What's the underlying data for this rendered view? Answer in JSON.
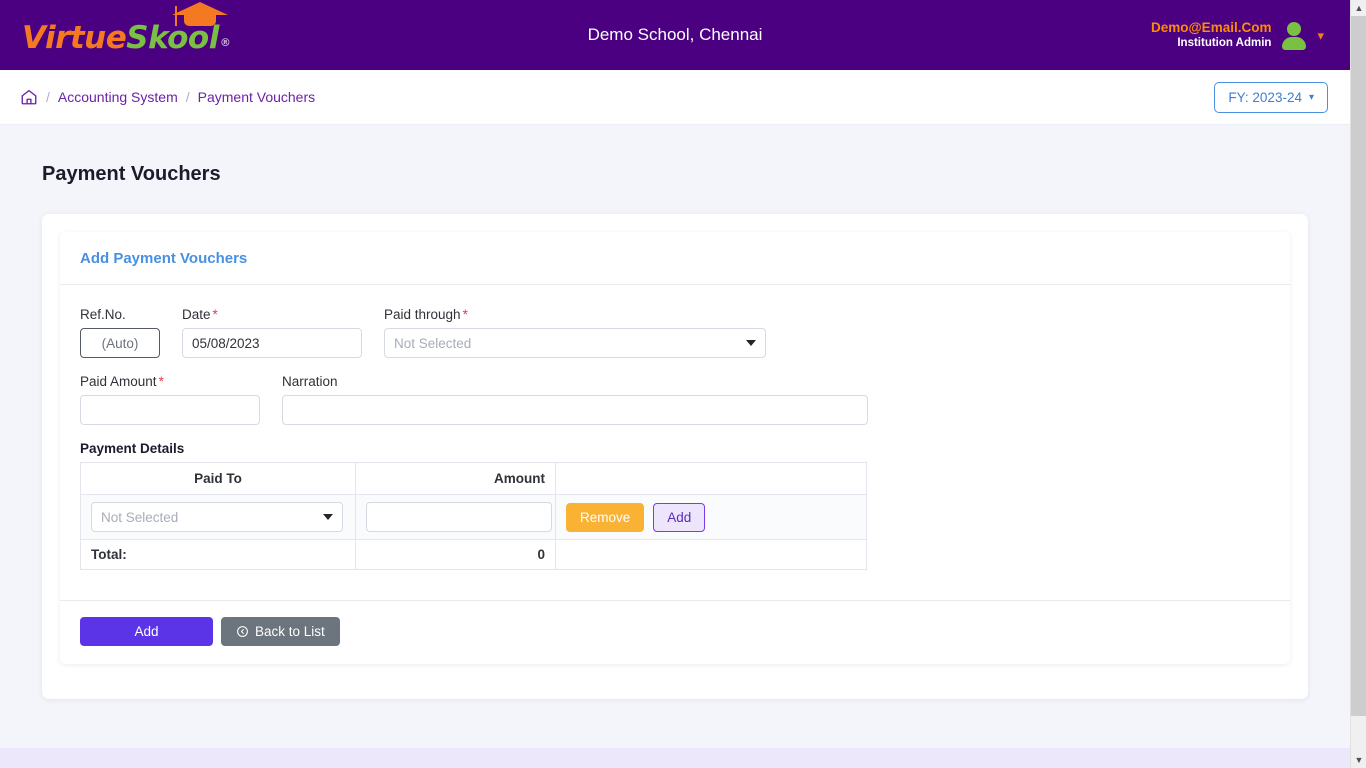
{
  "header": {
    "logo_virtue": "Virtue",
    "logo_skool": "Skool",
    "logo_reg": "®",
    "logo_icon": "graduation-cap-icon",
    "school_name": "Demo School, Chennai",
    "user_email": "Demo@Email.Com",
    "user_role": "Institution Admin",
    "avatar_icon": "user-avatar-icon",
    "caret_icon": "chevron-down-icon",
    "brand_purple": "#4B0082",
    "accent_orange": "#F47920",
    "accent_green": "#7AC143"
  },
  "breadcrumb": {
    "home_icon": "home-icon",
    "separator": "/",
    "items": [
      {
        "label": "Accounting System",
        "current": false
      },
      {
        "label": "Payment Vouchers",
        "current": true
      }
    ],
    "fy_label": "FY: 2023-24",
    "fy_caret": "chevron-down-icon",
    "fy_color": "#3D7FD0"
  },
  "page": {
    "title": "Payment Vouchers"
  },
  "card": {
    "title": "Add Payment Vouchers",
    "title_color": "#4A90E2"
  },
  "form": {
    "ref_no": {
      "label": "Ref.No.",
      "required": false,
      "value": "(Auto)"
    },
    "date": {
      "label": "Date",
      "required": true,
      "required_mark": "*",
      "value": "05/08/2023"
    },
    "paid_through": {
      "label": "Paid through",
      "required": true,
      "required_mark": "*",
      "value": "Not Selected",
      "caret_icon": "dropdown-caret-icon"
    },
    "paid_amount": {
      "label": "Paid Amount",
      "required": true,
      "required_mark": "*",
      "value": "",
      "placeholder": ""
    },
    "narration": {
      "label": "Narration",
      "required": false,
      "value": "",
      "placeholder": ""
    }
  },
  "payment_details": {
    "section_title": "Payment Details",
    "columns": [
      "Paid To",
      "Amount",
      ""
    ],
    "rows": [
      {
        "paid_to": "Not Selected",
        "amount": "",
        "remove_label": "Remove",
        "add_label": "Add"
      }
    ],
    "total_label": "Total:",
    "total_value": "0",
    "remove_color": "#F9B233",
    "add_color": "#7C3AED"
  },
  "actions": {
    "submit_label": "Add",
    "back_label": "Back to List",
    "back_icon": "circle-arrow-left-icon",
    "submit_color": "#5B34E8",
    "back_color": "#6C757D"
  },
  "scrollbar": {
    "up_icon": "scroll-up-arrow-icon",
    "down_icon": "scroll-down-arrow-icon"
  }
}
